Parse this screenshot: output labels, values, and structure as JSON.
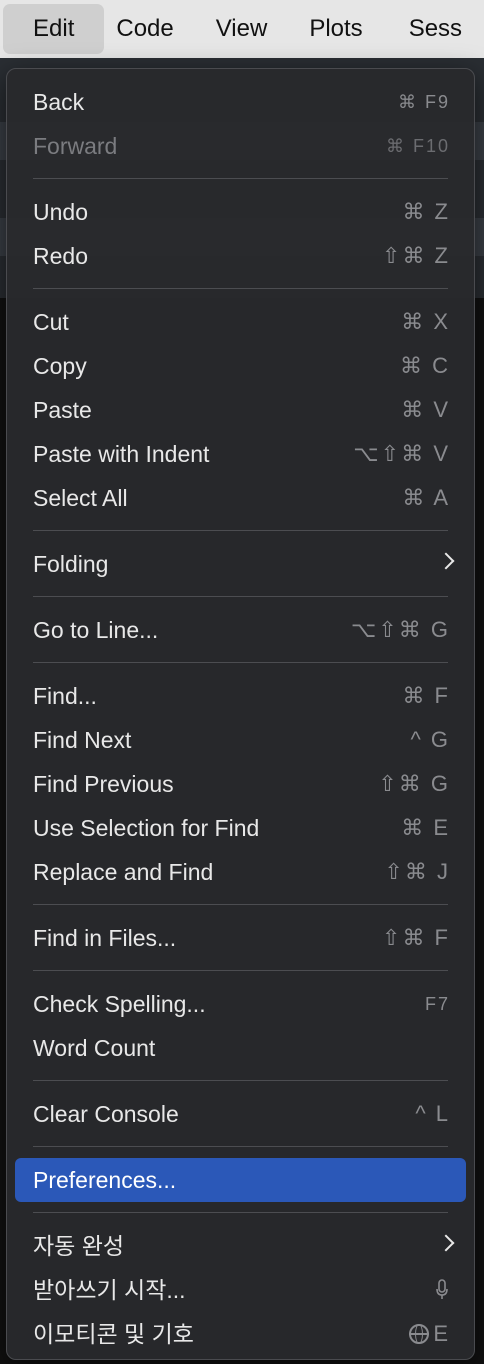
{
  "menubar": {
    "items": [
      "Edit",
      "Code",
      "View",
      "Plots",
      "Sess"
    ]
  },
  "menu": {
    "groups": [
      [
        {
          "label": "Back",
          "shortcut": "⌘ F9",
          "enabled": true
        },
        {
          "label": "Forward",
          "shortcut": "⌘ F10",
          "enabled": false
        }
      ],
      [
        {
          "label": "Undo",
          "shortcut": "⌘ Z",
          "enabled": true
        },
        {
          "label": "Redo",
          "shortcut": "⇧⌘ Z",
          "enabled": true
        }
      ],
      [
        {
          "label": "Cut",
          "shortcut": "⌘ X",
          "enabled": true
        },
        {
          "label": "Copy",
          "shortcut": "⌘ C",
          "enabled": true
        },
        {
          "label": "Paste",
          "shortcut": "⌘ V",
          "enabled": true
        },
        {
          "label": "Paste with Indent",
          "shortcut": "⌥⇧⌘ V",
          "enabled": true
        },
        {
          "label": "Select All",
          "shortcut": "⌘ A",
          "enabled": true
        }
      ],
      [
        {
          "label": "Folding",
          "submenu": true,
          "enabled": true
        }
      ],
      [
        {
          "label": "Go to Line...",
          "shortcut": "⌥⇧⌘ G",
          "enabled": true
        }
      ],
      [
        {
          "label": "Find...",
          "shortcut": "⌘ F",
          "enabled": true
        },
        {
          "label": "Find Next",
          "shortcut": "^ G",
          "enabled": true
        },
        {
          "label": "Find Previous",
          "shortcut": "⇧⌘ G",
          "enabled": true
        },
        {
          "label": "Use Selection for Find",
          "shortcut": "⌘ E",
          "enabled": true
        },
        {
          "label": "Replace and Find",
          "shortcut": "⇧⌘ J",
          "enabled": true
        }
      ],
      [
        {
          "label": "Find in Files...",
          "shortcut": "⇧⌘ F",
          "enabled": true
        }
      ],
      [
        {
          "label": "Check Spelling...",
          "shortcut": "F7",
          "enabled": true
        },
        {
          "label": "Word Count",
          "enabled": true
        }
      ],
      [
        {
          "label": "Clear Console",
          "shortcut": "^ L",
          "enabled": true
        }
      ],
      [
        {
          "label": "Preferences...",
          "enabled": true,
          "selected": true
        }
      ],
      [
        {
          "label": "자동 완성",
          "submenu": true,
          "enabled": true
        },
        {
          "label": "받아쓰기 시작...",
          "icon": "microphone-icon",
          "enabled": true
        },
        {
          "label": "이모티콘 및 기호",
          "icon": "globe-icon",
          "shortcut": "E",
          "enabled": true
        }
      ]
    ]
  },
  "colors": {
    "selected": "#2b58b8",
    "menu_bg": "#28292c",
    "text": "#e8e8e8",
    "shortcut": "#8a8b8f",
    "disabled": "#7b7c80"
  }
}
